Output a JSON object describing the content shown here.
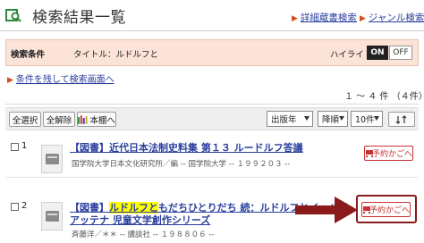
{
  "header": {
    "title": "検索結果一覧",
    "links": [
      {
        "label": "詳細蔵書検索"
      },
      {
        "label": "ジャンル検索"
      }
    ]
  },
  "condition": {
    "label": "検索条件",
    "value": "タイトル：ルドルフと",
    "highlight_label": "ハイライト：",
    "on_label": "ON",
    "off_label": "OFF"
  },
  "back_link": "条件を残して検索画面へ",
  "result_count": "１ ～ ４ 件 （４件）",
  "toolbar": {
    "select_all": "全選択",
    "deselect_all": "全解除",
    "bookshelf": "本棚へ",
    "sort_field": "出版年",
    "sort_order": "降順",
    "per_page": "10件"
  },
  "results": [
    {
      "num": "1",
      "type": "【図書】",
      "title": "近代日本法制史料集 第１３ ルードルフ答議",
      "sub": "国学院大学日本文化研究所／編 -- 国学院大学 -- １９９２０３ --",
      "reserve": "予約かごへ"
    },
    {
      "num": "2",
      "type": "【図書】",
      "title_highlight": "ルドルフと",
      "title_rest": "もだちひとりだち 続：ルドルフとイッパイ",
      "title_line2": "アッテナ 児童文学創作シリーズ",
      "sub": "斉藤洋／＊＊ -- 講談社 -- １９８８０６ --",
      "reserve": "予約かごへ"
    }
  ],
  "colors": {
    "link": "#2a3f9e",
    "condition_bg": "#fbe3d8",
    "reserve_red": "#c73333",
    "arrow": "#8b1a1a"
  }
}
